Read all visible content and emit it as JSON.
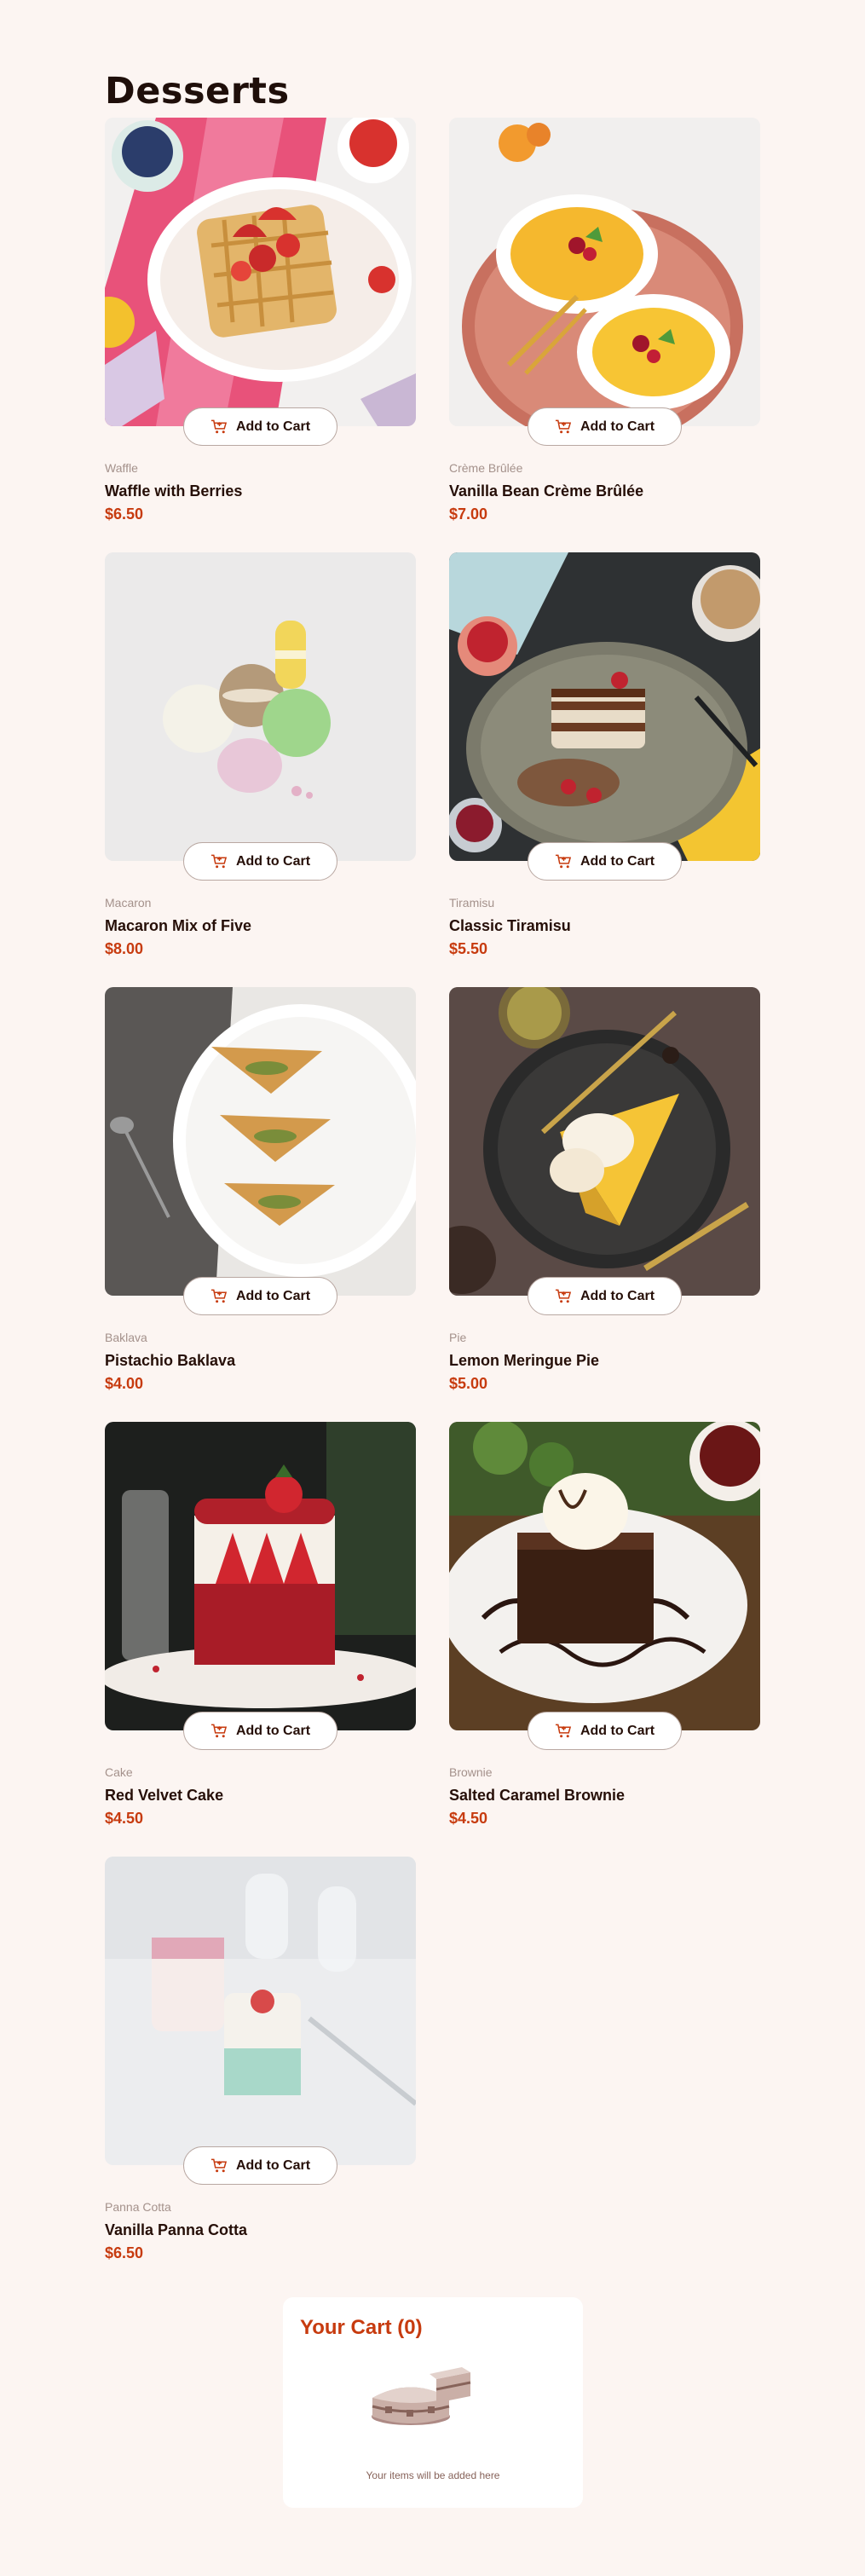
{
  "page": {
    "title": "Desserts"
  },
  "add_to_cart_label": "Add to Cart",
  "products": [
    {
      "category": "Waffle",
      "name": "Waffle with Berries",
      "price": "$6.50",
      "image": "waffle"
    },
    {
      "category": "Crème Brûlée",
      "name": "Vanilla Bean Crème Brûlée",
      "price": "$7.00",
      "image": "creme-brulee"
    },
    {
      "category": "Macaron",
      "name": "Macaron Mix of Five",
      "price": "$8.00",
      "image": "macaron"
    },
    {
      "category": "Tiramisu",
      "name": "Classic Tiramisu",
      "price": "$5.50",
      "image": "tiramisu"
    },
    {
      "category": "Baklava",
      "name": "Pistachio Baklava",
      "price": "$4.00",
      "image": "baklava"
    },
    {
      "category": "Pie",
      "name": "Lemon Meringue Pie",
      "price": "$5.00",
      "image": "pie"
    },
    {
      "category": "Cake",
      "name": "Red Velvet Cake",
      "price": "$4.50",
      "image": "cake"
    },
    {
      "category": "Brownie",
      "name": "Salted Caramel Brownie",
      "price": "$4.50",
      "image": "brownie"
    },
    {
      "category": "Panna Cotta",
      "name": "Vanilla Panna Cotta",
      "price": "$6.50",
      "image": "panna-cotta"
    }
  ],
  "cart": {
    "title": "Your Cart (0)",
    "empty_text": "Your items will be added here"
  },
  "colors": {
    "accent": "#c73b0f",
    "background": "#fcf5f2",
    "text": "#260f08",
    "muted": "#a4918b"
  }
}
